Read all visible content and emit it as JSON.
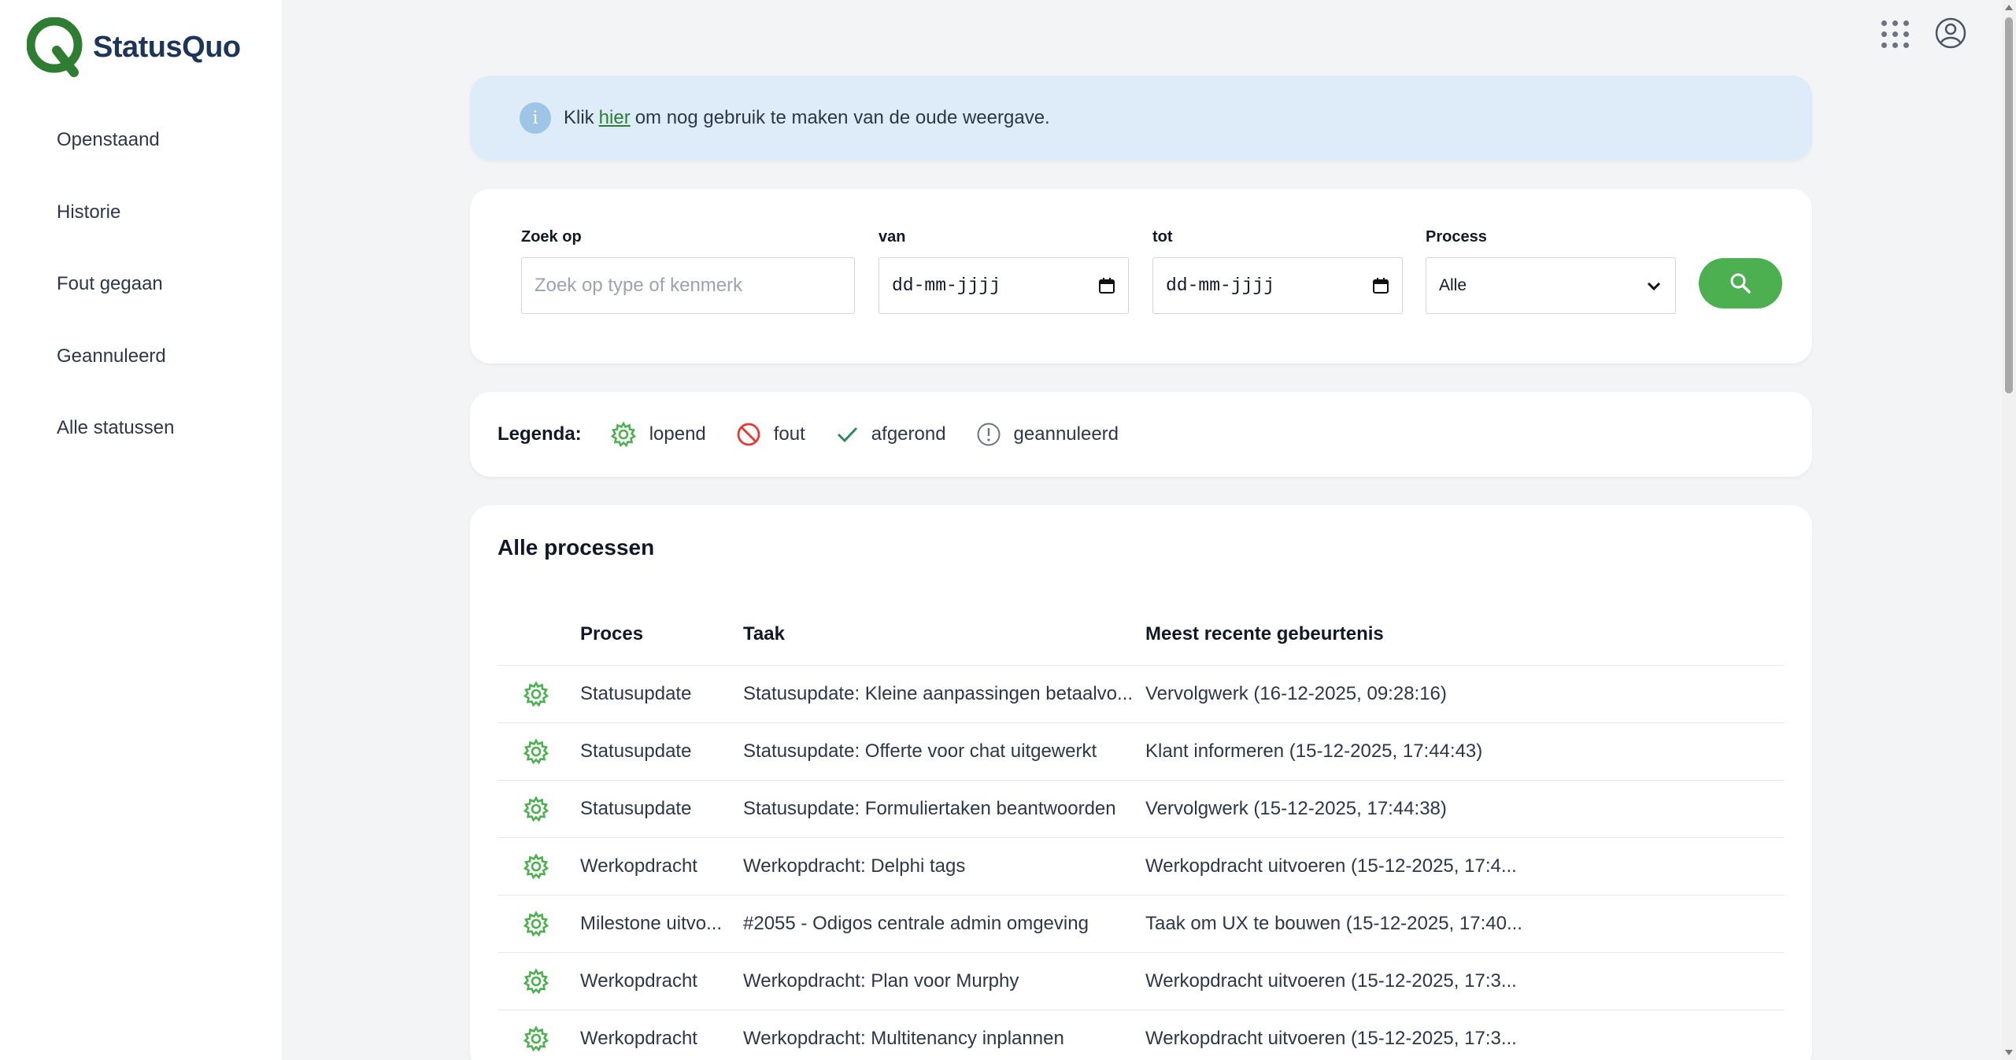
{
  "brand": {
    "name": "StatusQuo",
    "color": "#2e7d32"
  },
  "sidebar": {
    "items": [
      {
        "label": "Openstaand"
      },
      {
        "label": "Historie"
      },
      {
        "label": "Fout gegaan"
      },
      {
        "label": "Geannuleerd"
      },
      {
        "label": "Alle statussen"
      }
    ]
  },
  "topbar": {
    "apps_icon": "apps-grid-icon",
    "user_icon": "user-circle-icon"
  },
  "alert": {
    "prefix": "Klik",
    "link": "hier",
    "suffix": "om nog gebruik te maken van de oude weergave."
  },
  "search": {
    "zoek_label": "Zoek op",
    "zoek_placeholder": "Zoek op type of kenmerk",
    "van_label": "van",
    "van_value": "dd-mm-jjjj",
    "tot_label": "tot",
    "tot_value": "dd-mm-jjjj",
    "process_label": "Process",
    "process_value": "Alle",
    "button_color": "#4caf50"
  },
  "legend": {
    "title": "Legenda:",
    "items": [
      {
        "label": "lopend",
        "icon": "gear-icon"
      },
      {
        "label": "fout",
        "icon": "blocked-icon"
      },
      {
        "label": "afgerond",
        "icon": "check-icon"
      },
      {
        "label": "geannuleerd",
        "icon": "exclamation-circle-icon"
      }
    ]
  },
  "table": {
    "title": "Alle processen",
    "headers": {
      "proces": "Proces",
      "taak": "Taak",
      "recent": "Meest recente gebeurtenis"
    },
    "rows": [
      {
        "proces": "Statusupdate",
        "taak": "Statusupdate: Kleine aanpassingen betaalvo...",
        "recent": "Vervolgwerk (16-12-2025, 09:28:16)"
      },
      {
        "proces": "Statusupdate",
        "taak": "Statusupdate: Offerte voor chat uitgewerkt",
        "recent": "Klant informeren (15-12-2025, 17:44:43)"
      },
      {
        "proces": "Statusupdate",
        "taak": "Statusupdate: Formuliertaken beantwoorden",
        "recent": "Vervolgwerk (15-12-2025, 17:44:38)"
      },
      {
        "proces": "Werkopdracht",
        "taak": "Werkopdracht: Delphi tags",
        "recent": "Werkopdracht uitvoeren (15-12-2025, 17:4..."
      },
      {
        "proces": "Milestone uitvo...",
        "taak": "#2055 - Odigos centrale admin omgeving",
        "recent": "Taak om UX te bouwen (15-12-2025, 17:40..."
      },
      {
        "proces": "Werkopdracht",
        "taak": "Werkopdracht: Plan voor Murphy",
        "recent": "Werkopdracht uitvoeren (15-12-2025, 17:3..."
      },
      {
        "proces": "Werkopdracht",
        "taak": "Werkopdracht: Multitenancy inplannen",
        "recent": "Werkopdracht uitvoeren (15-12-2025, 17:3..."
      }
    ]
  }
}
